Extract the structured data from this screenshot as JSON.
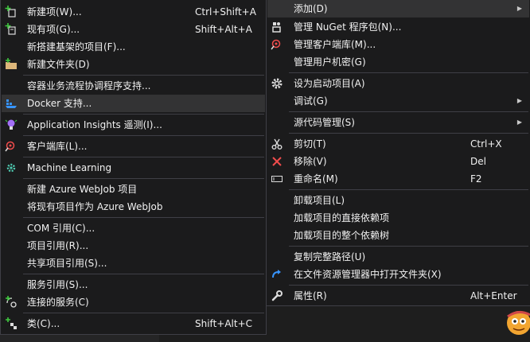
{
  "left_menu": {
    "new_item": "新建项(W)...",
    "new_item_shortcut": "Ctrl+Shift+A",
    "existing_item": "现有项(G)...",
    "existing_item_shortcut": "Shift+Alt+A",
    "new_scaffolded_item": "新搭建基架的项目(F)...",
    "new_folder": "新建文件夹(D)",
    "container_orchestration": "容器业务流程协调程序支持...",
    "docker_support": "Docker 支持...",
    "application_insights": "Application Insights 遥测(I)...",
    "client_library": "客户端库(L)...",
    "machine_learning": "Machine Learning",
    "new_azure_webjob": "新建 Azure WebJob 项目",
    "existing_as_webjob": "将现有项目作为 Azure WebJob",
    "com_reference": "COM 引用(C)...",
    "project_reference": "项目引用(R)...",
    "shared_project_reference": "共享项目引用(S)...",
    "service_reference": "服务引用(S)...",
    "connected_service": "连接的服务(C)",
    "class": "类(C)...",
    "class_shortcut": "Shift+Alt+C"
  },
  "right_menu": {
    "add": "添加(D)",
    "manage_nuget": "管理 NuGet 程序包(N)...",
    "manage_client_libraries": "管理客户端库(M)...",
    "manage_user_secrets": "管理用户机密(G)",
    "set_startup": "设为启动项目(A)",
    "debug": "调试(G)",
    "source_control": "源代码管理(S)",
    "cut": "剪切(T)",
    "cut_shortcut": "Ctrl+X",
    "remove": "移除(V)",
    "remove_shortcut": "Del",
    "rename": "重命名(M)",
    "rename_shortcut": "F2",
    "unload_project": "卸载项目(L)",
    "load_direct_dependencies": "加载项目的直接依赖项",
    "load_dependency_tree": "加载项目的整个依赖树",
    "copy_full_path": "复制完整路径(U)",
    "open_in_explorer": "在文件资源管理器中打开文件夹(X)",
    "properties": "属性(R)",
    "properties_shortcut": "Alt+Enter"
  },
  "icons": {
    "new_item": "new-item-icon",
    "existing_item": "existing-item-icon",
    "new_folder": "folder-icon",
    "docker": "docker-icon",
    "app_insights": "lightbulb-icon",
    "client_library": "client-library-icon",
    "machine_learning": "machine-learning-icon",
    "connected_service": "connected-service-icon",
    "class": "class-icon",
    "nuget": "nuget-icon",
    "settings": "gear-icon",
    "cut": "scissors-icon",
    "remove": "close-icon",
    "rename": "rename-icon",
    "open_folder": "refresh-arrow-icon",
    "properties": "wrench-icon"
  },
  "colors": {
    "menu_bg": "#1b1b1c",
    "border": "#3f3f46",
    "selected_bg": "#333334",
    "text": "#f1f1f1",
    "accent_red": "#f14c4c",
    "accent_blue": "#3794ff"
  }
}
